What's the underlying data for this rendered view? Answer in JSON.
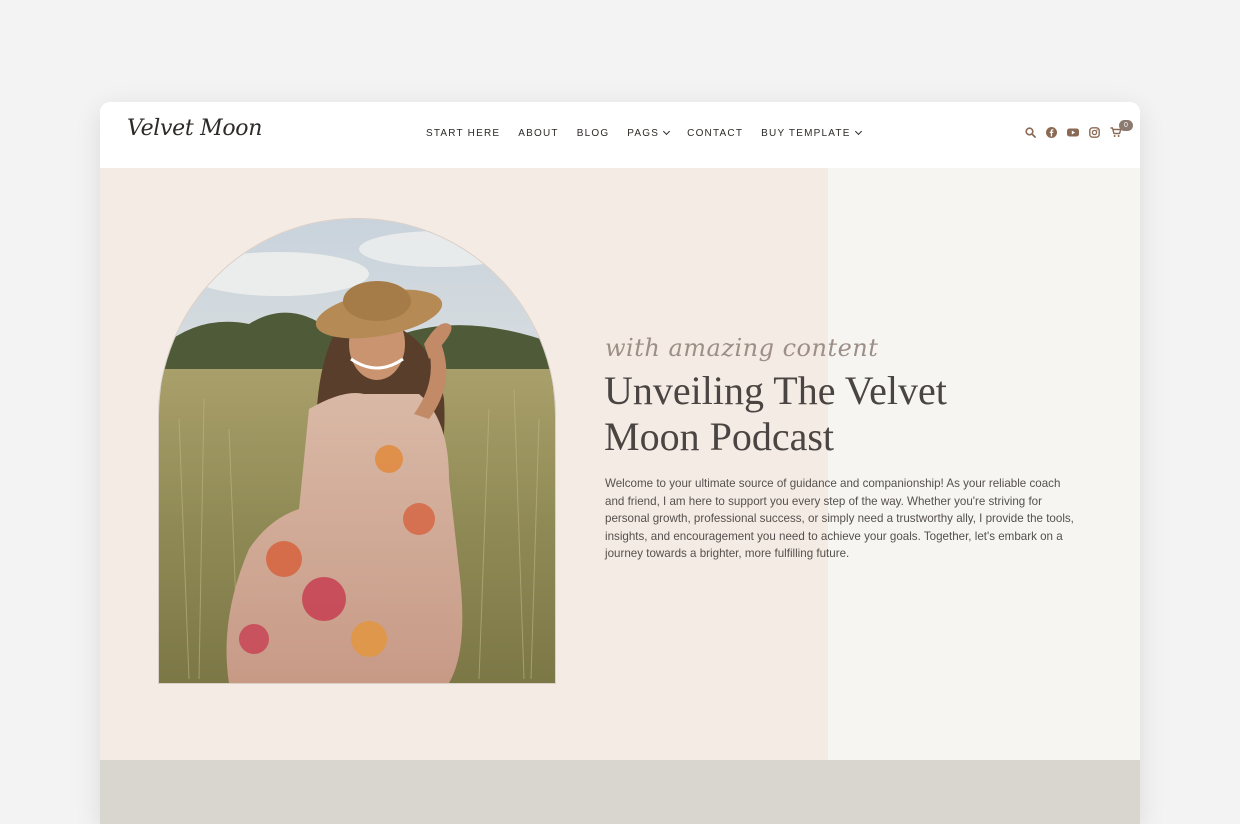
{
  "brand": {
    "logo_text": "Velvet Moon"
  },
  "nav": {
    "items": [
      {
        "label": "START HERE",
        "dropdown": false
      },
      {
        "label": "ABOUT",
        "dropdown": false
      },
      {
        "label": "BLOG",
        "dropdown": false
      },
      {
        "label": "PAGS",
        "dropdown": true
      },
      {
        "label": "CONTACT",
        "dropdown": false
      },
      {
        "label": "BUY TEMPLATE",
        "dropdown": true
      }
    ]
  },
  "header_icons": {
    "search": "search-icon",
    "facebook": "facebook-icon",
    "youtube": "youtube-icon",
    "instagram": "instagram-icon",
    "cart": "cart-icon",
    "cart_count": "0",
    "accent_color": "#8b6a55"
  },
  "hero": {
    "script_text": "with amazing content",
    "title": "Unveiling The Velvet Moon Podcast",
    "body": "Welcome to your ultimate source of guidance and companionship! As your reliable coach and friend, I am here to support you every step of the way. Whether you're striving for personal growth, professional success, or simply need a trustworthy ally, I provide the tools, insights, and encouragement you need to achieve your goals. Together, let's embark on a journey towards a brighter, more fulfilling future.",
    "image": "woman-in-straw-hat-in-field-photo"
  },
  "colors": {
    "hero_left_bg": "#f5ebe5",
    "hero_right_bg": "#f7f5f2",
    "footer_band": "#d8d6cf"
  }
}
